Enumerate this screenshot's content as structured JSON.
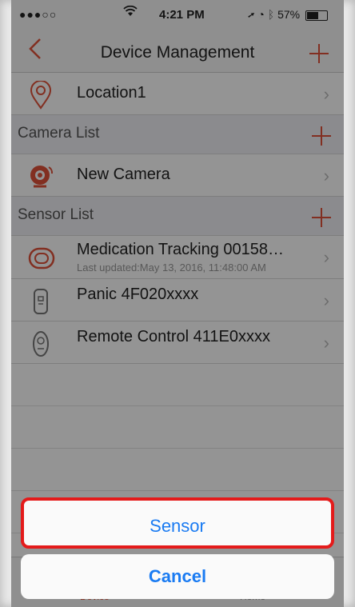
{
  "status": {
    "signal_dots": "●●●○○",
    "time": "4:21 PM",
    "battery": "57%",
    "battery_level": 0.57
  },
  "nav": {
    "back_icon": "chevron-left-icon",
    "title": "Device Management",
    "add_icon": "plus-icon"
  },
  "location": {
    "label": "Location1",
    "icon": "location-pin-icon"
  },
  "camera_section": {
    "label": "Camera List"
  },
  "cameras": [
    {
      "label": "New Camera",
      "icon": "camera-icon"
    }
  ],
  "sensor_section": {
    "label": "Sensor List"
  },
  "sensors": [
    {
      "label": "Medication Tracking 00158…",
      "sub": "Last updated:May 13, 2016, 11:48:00 AM",
      "icon": "medication-sensor-icon"
    },
    {
      "label": "Panic 4F020xxxx",
      "icon": "panic-button-icon"
    },
    {
      "label": "Remote Control 411E0xxxx",
      "icon": "remote-control-icon"
    }
  ],
  "tabbar": {
    "device": "Device",
    "home": "Home"
  },
  "action_sheet": {
    "sensor": "Sensor",
    "cancel": "Cancel"
  },
  "colors": {
    "accent": "#e0523a",
    "action_blue": "#1a7bf2",
    "highlight": "#e41b1b"
  }
}
